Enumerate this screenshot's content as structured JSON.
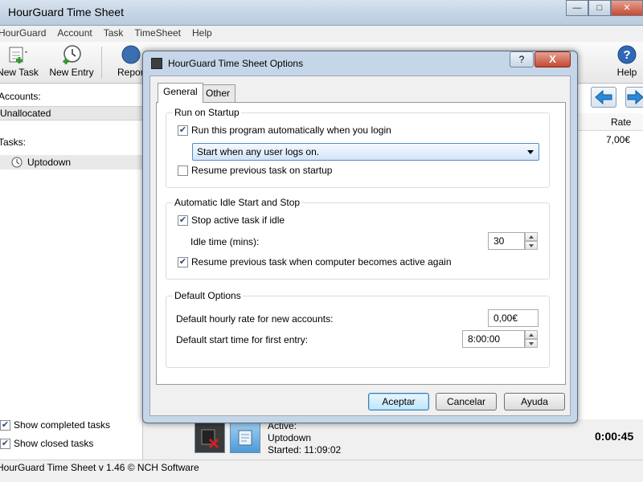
{
  "app": {
    "title": "HourGuard Time Sheet",
    "window_controls": {
      "minimize": "—",
      "maximize": "□",
      "close": "✕"
    }
  },
  "menu": [
    "HourGuard",
    "Account",
    "Task",
    "TimeSheet",
    "Help"
  ],
  "toolbar": {
    "new_task": "New Task",
    "new_entry": "New Entry",
    "report": "Repor",
    "help": "Help"
  },
  "left_panel": {
    "accounts_label": "Accounts:",
    "account_selected": "Unallocated",
    "tasks_label": "Tasks:",
    "task_item": "Uptodown",
    "show_completed": "Show completed tasks",
    "show_closed": "Show closed tasks",
    "show_completed_checked": true,
    "show_closed_checked": true
  },
  "grid": {
    "rate_header": "Rate",
    "rate_value": "7,00€"
  },
  "timer": {
    "active_label": "Active:",
    "task_name": "Uptodown",
    "started": "Started: 11:09:02",
    "elapsed": "0:00:45"
  },
  "status_bar": "HourGuard Time Sheet v 1.46 © NCH Software",
  "dialog": {
    "title": "HourGuard Time Sheet Options",
    "help_button": "?",
    "close_button": "X",
    "tabs": [
      "General",
      "Other"
    ],
    "active_tab": "General",
    "run_on_startup": {
      "title": "Run on Startup",
      "run_auto_label": "Run this program automatically when you login",
      "run_auto_checked": true,
      "startup_mode": "Start when any user logs on.",
      "resume_label": "Resume previous task on startup",
      "resume_checked": false
    },
    "idle": {
      "title": "Automatic Idle Start and Stop",
      "stop_idle_label": "Stop active task if idle",
      "stop_idle_checked": true,
      "idle_time_label": "Idle time (mins):",
      "idle_time_value": "30",
      "resume_active_label": "Resume previous task when computer becomes active again",
      "resume_active_checked": true
    },
    "defaults": {
      "title": "Default Options",
      "hourly_rate_label": "Default hourly rate for new accounts:",
      "hourly_rate_value": "0,00€",
      "start_time_label": "Default start time for first entry:",
      "start_time_value": "8:00:00"
    },
    "buttons": {
      "accept": "Aceptar",
      "cancel": "Cancelar",
      "help": "Ayuda"
    }
  },
  "colors": {
    "dialog_frame": "#c5d6e8",
    "close_red": "#c44a32",
    "default_button": "#bee6fd"
  }
}
